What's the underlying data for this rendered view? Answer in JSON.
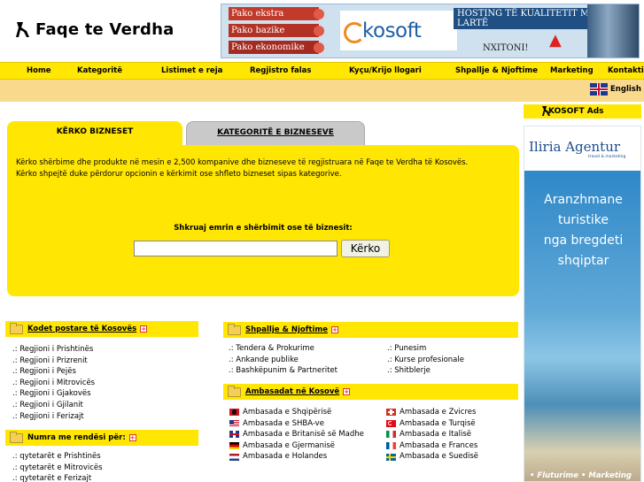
{
  "site": {
    "logo_text": "Faqe te Verdha"
  },
  "banner": {
    "packages": [
      "Pako ekstra",
      "Pako bazike",
      "Pako ekonomike"
    ],
    "brand": "kosoft",
    "tagline": "HOSTING TË KUALITETIT ME TË LARTË",
    "cta": "NXITONI!"
  },
  "nav": {
    "items": [
      {
        "label": "Home"
      },
      {
        "label": "Kategoritë"
      },
      {
        "label": "Listimet e reja"
      },
      {
        "label": "Regjistro falas"
      },
      {
        "label": "Kyçu/Krijo llogari"
      },
      {
        "label": "Shpallje & Njoftime"
      },
      {
        "label": "Marketing"
      },
      {
        "label": "Kontakti"
      }
    ]
  },
  "language": {
    "label": "English",
    "icon": "uk-flag-icon"
  },
  "search": {
    "tab_active": "KËRKO BIZNESET",
    "tab_inactive": "KATEGORITË E BIZNESEVE",
    "description_1": "Kërko shërbime dhe produkte në mesin e 2,500 kompanive dhe bizneseve të regjistruara në Faqe te Verdha të Kosovës.",
    "description_2": "Kërko shpejtë duke përdorur opcionin e kërkimit ose shfleto bizneset sipas kategorive.",
    "label": "Shkruaj emrin e shërbimit ose të biznesit:",
    "input_value": "",
    "button_label": "Kërko"
  },
  "sidebar": {
    "ads_title": "KOSOFT Ads",
    "ad": {
      "brand": "Iliria Agentur",
      "sub": "travel & marketing",
      "copy": [
        "Aranzhmane",
        "turistike",
        "nga bregdeti",
        "shqiptar"
      ],
      "footer": "• Fluturime • Marketing"
    }
  },
  "postal": {
    "title": "Kodet postare të Kosovës",
    "items": [
      ".: Regjioni i Prishtinës",
      ".: Regjioni i Prizrenit",
      ".: Regjioni i Pejës",
      ".: Regjioni i Mitrovicës",
      ".: Regjioni i Gjakovës",
      ".: Regjioni i Gjilanit",
      ".: Regjioni i Ferizajt"
    ]
  },
  "numbers": {
    "title": "Numra me rendësi për:",
    "items": [
      ".: qytetarët e Prishtinës",
      ".: qytetarët e Mitrovicës",
      ".: qytetarët e Ferizajt"
    ]
  },
  "announcements": {
    "title": "Shpallje & Njoftime",
    "left": [
      ".: Tendera & Prokurime",
      ".: Ankande publike",
      ".: Bashkëpunim & Partneritet"
    ],
    "right": [
      ".: Punesim",
      ".: Kurse profesionale",
      ".: Shitblerje"
    ]
  },
  "embassies": {
    "title": "Ambasadat në Kosovë",
    "left": [
      {
        "label": "Ambasada e Shqipërisë",
        "flag": "albania-flag-icon"
      },
      {
        "label": "Ambasada e SHBA-ve",
        "flag": "usa-flag-icon"
      },
      {
        "label": "Ambasada e Britanisë së Madhe",
        "flag": "uk-flag-icon"
      },
      {
        "label": "Ambasada e Gjermanisë",
        "flag": "germany-flag-icon"
      },
      {
        "label": "Ambasada e Holandes",
        "flag": "netherlands-flag-icon"
      }
    ],
    "right": [
      {
        "label": "Ambasada e Zvicres",
        "flag": "switzerland-flag-icon"
      },
      {
        "label": "Ambasada e Turqisë",
        "flag": "turkey-flag-icon"
      },
      {
        "label": "Ambasada e Italisë",
        "flag": "italy-flag-icon"
      },
      {
        "label": "Ambasada e Frances",
        "flag": "france-flag-icon"
      },
      {
        "label": "Ambasada e Suedisë",
        "flag": "sweden-flag-icon"
      }
    ]
  },
  "colors": {
    "brand_yellow": "#ffe603",
    "subbar": "#f9d98c",
    "tab_inactive": "#c9c9c9"
  }
}
